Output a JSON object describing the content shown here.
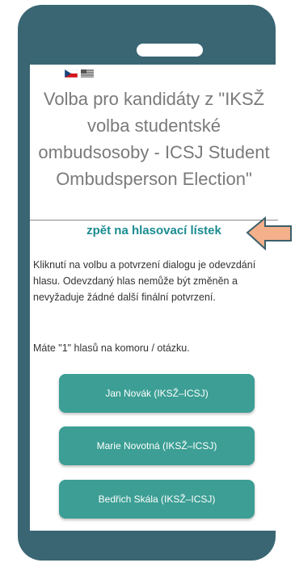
{
  "flags": [
    {
      "name": "czech-flag-icon"
    },
    {
      "name": "english-flag-icon"
    }
  ],
  "title": "Volba pro kandidáty z \"IKSŽ volba studentské ombudsosoby - ICSJ Student Ombudsperson Election\"",
  "back_link": "zpět na hlasovací lístek",
  "info_text": "Kliknutí na volbu a potvrzení dialogu je odevzdání hlasu. Odevzdaný hlas nemůže být změněn a nevyžaduje žádné další finální potvrzení.",
  "votes_text": "Máte \"1\" hlasů na komoru / otázku.",
  "candidates": [
    "Jan Novák (IKSŽ–ICSJ)",
    "Marie Novotná (IKSŽ–ICSJ)",
    "Bedřich Skála (IKSŽ–ICSJ)"
  ],
  "colors": {
    "phone": "#3a6674",
    "accent": "#1a8c92",
    "button": "#3c9e94",
    "arrow_fill": "#f4b08a",
    "arrow_stroke": "#3d5f6b"
  }
}
